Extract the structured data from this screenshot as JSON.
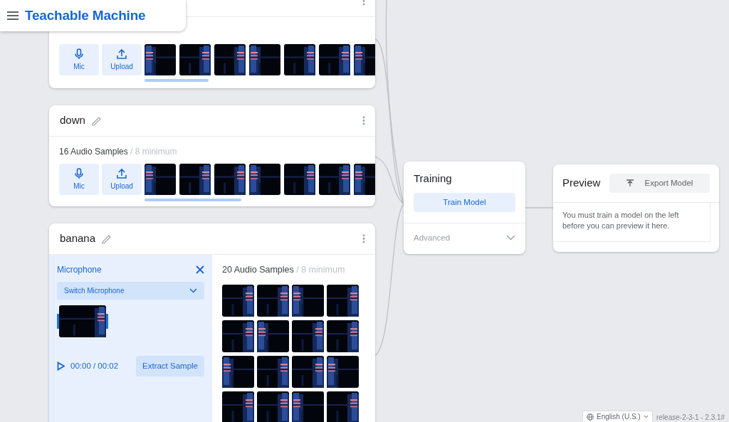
{
  "header": {
    "title": "Teachable Machine"
  },
  "classes": [
    {
      "kind": "collapsed",
      "buttons": [
        "Mic",
        "Upload"
      ],
      "samples": [
        {
          "kind": "picture"
        },
        {
          "kind": "picture"
        },
        {
          "kind": "picture"
        },
        {
          "kind": "picture"
        },
        {
          "kind": "picture"
        },
        {
          "kind": "picture"
        },
        {
          "kind": "picture"
        }
      ]
    },
    {
      "kind": "collapsed",
      "name": "down",
      "sample_count": "16 Audio Samples",
      "minimum": "/ 8 minimum",
      "buttons": [
        "Mic",
        "Upload"
      ],
      "samples": [
        {
          "kind": "picture"
        },
        {
          "kind": "picture"
        },
        {
          "kind": "picture"
        },
        {
          "kind": "picture"
        },
        {
          "kind": "picture"
        },
        {
          "kind": "picture"
        },
        {
          "kind": "picture"
        }
      ]
    },
    {
      "kind": "recording",
      "name": "banana",
      "recorder": {
        "title": "Microphone",
        "dropdown": "Switch Microphone",
        "time": "00:00 / 00:02",
        "button": "Extract Sample"
      },
      "sample_count": "20 Audio Samples",
      "minimum": "/ 8 minimum",
      "samples": [
        {
          "kind": "picture"
        },
        {
          "kind": "picture"
        },
        {
          "kind": "picture"
        },
        {
          "kind": "picture"
        },
        {
          "kind": "picture"
        },
        {
          "kind": "picture"
        },
        {
          "kind": "picture"
        },
        {
          "kind": "picture"
        },
        {
          "kind": "picture"
        },
        {
          "kind": "picture"
        },
        {
          "kind": "picture"
        },
        {
          "kind": "picture"
        },
        {
          "kind": "picture"
        },
        {
          "kind": "picture"
        },
        {
          "kind": "picture"
        },
        {
          "kind": "picture"
        }
      ]
    }
  ],
  "training": {
    "title": "Training",
    "button": "Train Model",
    "advanced": "Advanced",
    "expanded": false
  },
  "preview": {
    "title": "Preview",
    "button": "Export Model",
    "message": "You must train a model on the left before you can preview it here."
  },
  "footer": {
    "language": "English (U.S.)",
    "version": "release-2-3-1 - 2.3.1#"
  }
}
